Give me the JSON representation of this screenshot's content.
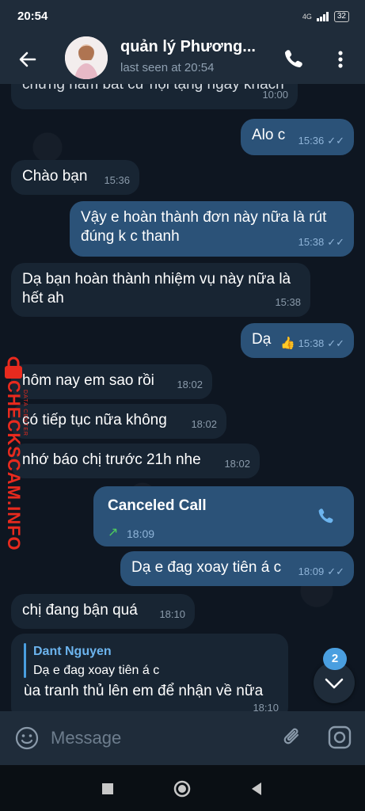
{
  "status": {
    "time": "20:54",
    "network": "4G",
    "battery": "32"
  },
  "header": {
    "name": "quản lý Phương...",
    "last_seen": "last seen at 20:54"
  },
  "messages": [
    {
      "dir": "in",
      "text": "chứng nằm bất cứ nội tạng ngày khách",
      "time": "10:00"
    },
    {
      "dir": "out",
      "text": "Alo c",
      "time": "15:36"
    },
    {
      "dir": "in",
      "text": "Chào bạn",
      "time": "15:36"
    },
    {
      "dir": "out",
      "line1": "Vậy e hoàn thành đơn này nữa là rút",
      "line2": "đúng k c thanh",
      "time": "15:38"
    },
    {
      "dir": "in",
      "line1": "Dạ bạn hoàn thành nhiệm vụ này nữa là",
      "line2": "hết ah",
      "time": "15:38"
    },
    {
      "dir": "out",
      "text": "Dạ",
      "emoji": "👍",
      "time": "15:38"
    },
    {
      "dir": "in",
      "text": "hôm nay em sao rồi",
      "time": "18:02"
    },
    {
      "dir": "in",
      "text": "có tiếp tục nữa không",
      "time": "18:02"
    },
    {
      "dir": "in",
      "text": "nhớ báo chị trước 21h nhe",
      "time": "18:02"
    },
    {
      "dir": "out",
      "call_title": "Canceled Call",
      "time": "18:09"
    },
    {
      "dir": "out",
      "text": "Dạ e đag xoay tiên á c",
      "time": "18:09"
    },
    {
      "dir": "in",
      "text": "chị đang bận quá",
      "time": "18:10"
    },
    {
      "dir": "in",
      "reply_name": "Dant Nguyen",
      "reply_text": "Dạ e đag xoay tiên á c",
      "text": "ùa tranh thủ lên em để nhận về nữa",
      "time": "18:10"
    }
  ],
  "scroll": {
    "badge": "2"
  },
  "input": {
    "placeholder": "Message"
  },
  "watermark": {
    "brand": "CHECKSCAM.INFO",
    "sub": "DATA CENTER"
  },
  "colors": {
    "accent": "#4a9fe0",
    "out_bubble": "#2b5278",
    "in_bubble": "#182533",
    "bg": "#0e1621",
    "call_arrow": "#4fce5d"
  }
}
